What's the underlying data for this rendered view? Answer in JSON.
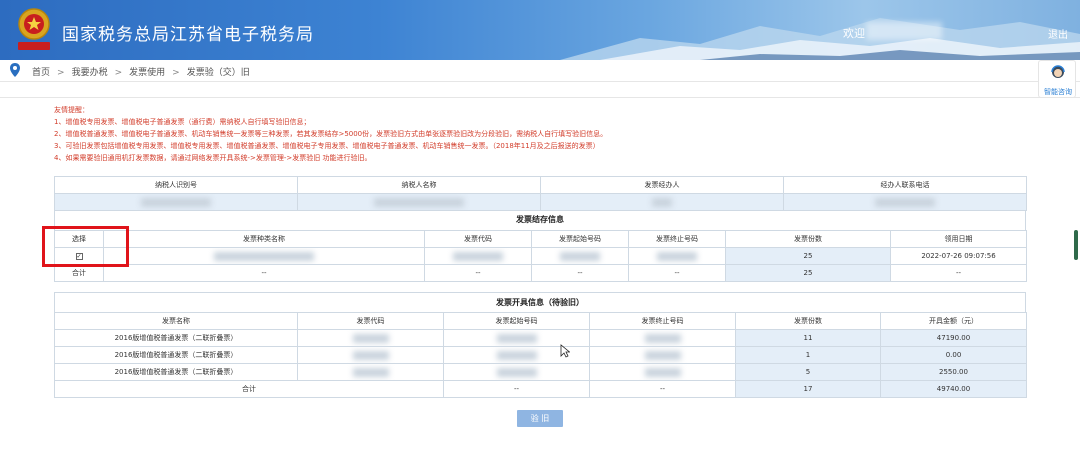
{
  "header": {
    "title": "国家税务总局江苏省电子税务局",
    "welcome": "欢迎",
    "logout": "退出",
    "emblem_caption": "中国税务"
  },
  "breadcrumb": [
    "首页",
    "我要办税",
    "发票使用",
    "发票验（交）旧"
  ],
  "assistant": {
    "label": "智能咨询"
  },
  "notice": [
    "友情提醒：",
    "1、增值税专用发票、增值税电子普通发票（通行费）需纳税人自行填写验旧信息；",
    "2、增值税普通发票、增值税电子普通发票、机动车销售统一发票等三种发票，若其发票结存>5000份，发票验旧方式由单张逐票验旧改为分段验旧，需纳税人自行填写验旧信息。",
    "3、可验旧发票包括增值税专用发票、增值税专用发票、增值税普通发票、增值税电子专用发票、增值税电子普通发票、机动车销售统一发票。（2018年11月及之后报送的发票）",
    "4、如果需要验旧通用机打发票数据，请通过网络发票开具系统->发票管理->发票验旧 功能进行验旧。"
  ],
  "taxpayer_table": {
    "headers": [
      "纳税人识别号",
      "纳税人名称",
      "发票经办人",
      "经办人联系电话"
    ]
  },
  "stock_table": {
    "caption": "发票结存信息",
    "headers": [
      "选择",
      "发票种类名称",
      "发票代码",
      "发票起始号码",
      "发票终止号码",
      "发票份数",
      "领用日期"
    ],
    "row": {
      "count": "25",
      "date": "2022-07-26 09:07:56",
      "check": "✓"
    },
    "total": {
      "label": "合计",
      "c1": "--",
      "c2": "--",
      "c3": "--",
      "c4": "--",
      "count": "25",
      "c6": "--"
    }
  },
  "issued_table": {
    "caption": "发票开具信息（待验旧）",
    "headers": [
      "发票名称",
      "发票代码",
      "发票起始号码",
      "发票终止号码",
      "发票份数",
      "开具金额（元）"
    ],
    "rows": [
      {
        "name": "2016版增值税普通发票（二联折叠票）",
        "count": "11",
        "amount": "47190.00"
      },
      {
        "name": "2016版增值税普通发票（二联折叠票）",
        "count": "1",
        "amount": "0.00"
      },
      {
        "name": "2016版增值税普通发票（二联折叠票）",
        "count": "5",
        "amount": "2550.00"
      }
    ],
    "total": {
      "label": "合计",
      "c2": "--",
      "c3": "--",
      "count": "17",
      "amount": "49740.00"
    }
  },
  "submit_label": "验 旧",
  "colors": {
    "accent": "#3d83d3",
    "notice": "#d23c2a",
    "highlight": "#e0141a",
    "cell_blue": "#e4eef8"
  }
}
